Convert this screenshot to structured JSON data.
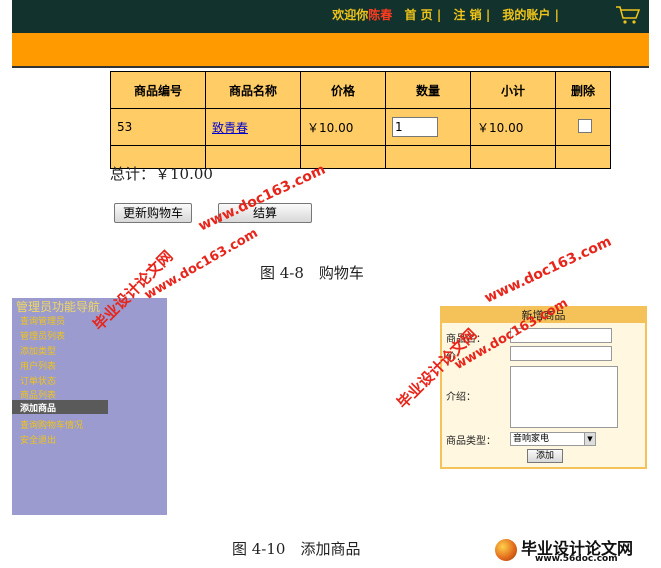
{
  "header": {
    "welcome_prefix": "欢迎你",
    "username": "陈春",
    "links": [
      "首 页",
      "注 销",
      "我的账户"
    ],
    "separator": "|"
  },
  "cart_table": {
    "headers": [
      "商品编号",
      "商品名称",
      "价格",
      "数量",
      "小计",
      "删除"
    ],
    "row": {
      "id": "53",
      "name": "致青春",
      "price": "￥10.00",
      "quantity": "1",
      "subtotal": "￥10.00"
    }
  },
  "total": "总计：￥10.00",
  "buttons": {
    "update": "更新购物车",
    "checkout": "结算"
  },
  "captions": {
    "fig1": "图 4-8　购物车",
    "fig2": "图 4-10　添加商品"
  },
  "admin_panel": {
    "title": "管理员功能导航",
    "menu": [
      "查询管理员",
      "管理员列表",
      "添加类型",
      "用户列表",
      "订单状态",
      "商品列表"
    ],
    "active_item": "添加商品",
    "menu_after": [
      "查询购物车情况",
      "安全退出"
    ]
  },
  "add_form": {
    "title": "新增商品",
    "labels": {
      "name": "商品名：",
      "price": "价：",
      "intro": "介绍：",
      "type": "商品类型："
    },
    "type_value": "音响家电",
    "submit": "添加"
  },
  "watermark": {
    "cn": "毕业设计论文网",
    "url": "www.doc163.com"
  },
  "logo": {
    "text": "毕业设计论文网",
    "url": "www.56doc.com"
  }
}
